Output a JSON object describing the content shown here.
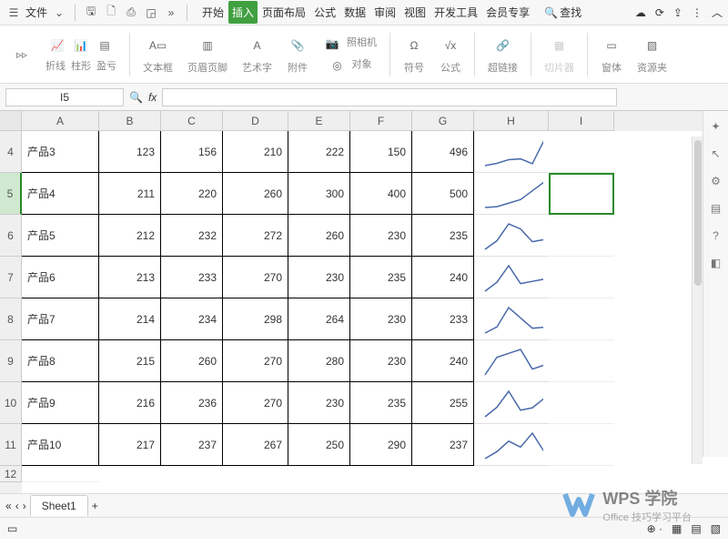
{
  "menu": {
    "file": "文件"
  },
  "tabs": [
    "开始",
    "插入",
    "页面布局",
    "公式",
    "数据",
    "审阅",
    "视图",
    "开发工具",
    "会员专享"
  ],
  "activeTab": 1,
  "search": "查找",
  "ribbon": {
    "sparkline": {
      "line": "折线",
      "column": "柱形",
      "winloss": "盈亏"
    },
    "text": {
      "textbox": "文本框",
      "headerfooter": "页眉页脚",
      "wordart": "艺术字",
      "attach": "附件"
    },
    "camera": {
      "camera": "照相机",
      "object": "对象"
    },
    "symbol": "符号",
    "formula": "公式",
    "hyperlink": "超链接",
    "slicer": "切片器",
    "window": "窗体",
    "resource": "资源夹"
  },
  "namebox": "I5",
  "fx": "fx",
  "cols": [
    "A",
    "B",
    "C",
    "D",
    "E",
    "F",
    "G",
    "H",
    "I"
  ],
  "rows": [
    {
      "n": 4,
      "name": "产品3",
      "v": [
        123,
        156,
        210,
        222,
        150,
        496
      ]
    },
    {
      "n": 5,
      "name": "产品4",
      "v": [
        211,
        220,
        260,
        300,
        400,
        500
      ]
    },
    {
      "n": 6,
      "name": "产品5",
      "v": [
        212,
        232,
        272,
        260,
        230,
        235
      ]
    },
    {
      "n": 7,
      "name": "产品6",
      "v": [
        213,
        233,
        270,
        230,
        235,
        240
      ]
    },
    {
      "n": 8,
      "name": "产品7",
      "v": [
        214,
        234,
        298,
        264,
        230,
        233
      ]
    },
    {
      "n": 9,
      "name": "产品8",
      "v": [
        215,
        260,
        270,
        280,
        230,
        240
      ]
    },
    {
      "n": 10,
      "name": "产品9",
      "v": [
        216,
        236,
        270,
        230,
        235,
        255
      ]
    },
    {
      "n": 11,
      "name": "产品10",
      "v": [
        217,
        237,
        267,
        250,
        290,
        237
      ]
    }
  ],
  "selectedRow": 5,
  "sheets": [
    "Sheet1"
  ],
  "watermark": {
    "brand": "WPS 学院",
    "sub": "Office 技巧学习平台"
  }
}
